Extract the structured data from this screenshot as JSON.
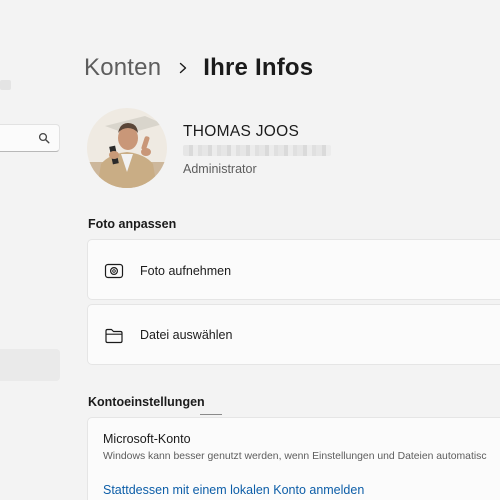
{
  "breadcrumb": {
    "parent": "Konten",
    "current": "Ihre Infos"
  },
  "profile": {
    "name": "THOMAS JOOS",
    "role": "Administrator"
  },
  "photo_section": {
    "title": "Foto anpassen",
    "take_photo_label": "Foto aufnehmen",
    "choose_file_label": "Datei auswählen"
  },
  "account_section": {
    "title": "Kontoeinstellungen",
    "account_title": "Microsoft-Konto",
    "account_description": "Windows kann besser genutzt werden, wenn Einstellungen und Dateien automatisc",
    "local_account_link": "Stattdessen mit einem lokalen Konto anmelden"
  },
  "icons": {
    "search": "search-icon",
    "breadcrumb_separator": "chevron-right-icon",
    "take_photo": "camera-icon",
    "choose_file": "folder-icon"
  },
  "colors": {
    "background": "#f3f3f3",
    "card": "#fbfbfb",
    "link": "#0d5ea8",
    "secondary_text": "#5d5d5d"
  }
}
